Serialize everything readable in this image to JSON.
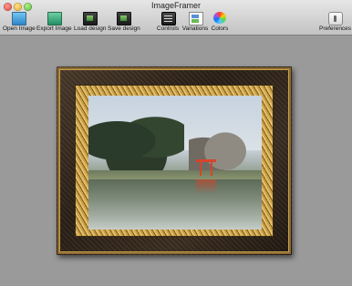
{
  "window": {
    "title": "ImageFramer"
  },
  "toolbar": {
    "items": [
      {
        "label": "Open Image",
        "icon": "open-image-icon"
      },
      {
        "label": "Export Image",
        "icon": "export-image-icon"
      },
      {
        "label": "Load design",
        "icon": "load-design-icon"
      },
      {
        "label": "Save design",
        "icon": "save-design-icon"
      },
      {
        "label": "Controls",
        "icon": "controls-icon"
      },
      {
        "label": "Variations",
        "icon": "variations-icon"
      },
      {
        "label": "Colors",
        "icon": "colors-icon"
      },
      {
        "label": "Preferences",
        "icon": "preferences-icon"
      }
    ]
  },
  "colors": {
    "canvas_background": "#9a9a9a",
    "frame_wood": "#2a1f16",
    "frame_gold": "#c99e44",
    "torii_red": "#d6452b"
  }
}
